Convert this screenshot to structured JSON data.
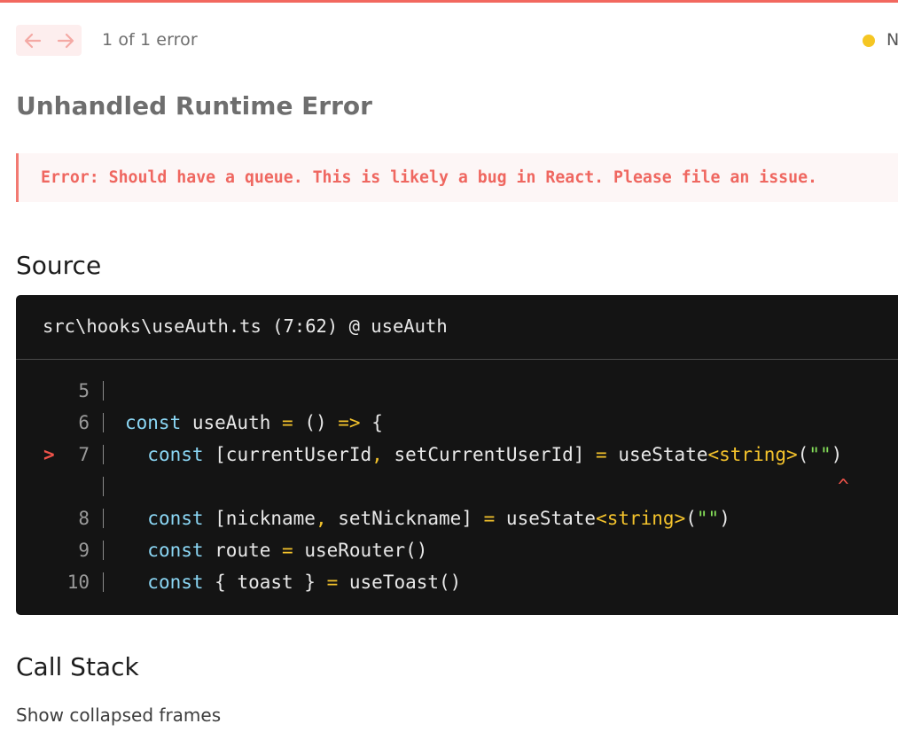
{
  "toolbar": {
    "error_count": "1 of 1 error",
    "status_text": "N"
  },
  "title": "Unhandled Runtime Error",
  "error_message": "Error: Should have a queue. This is likely a bug in React. Please file an issue.",
  "source": {
    "heading": "Source",
    "file_location": "src\\hooks\\useAuth.ts (7:62) @ useAuth",
    "lines": [
      {
        "num": "5",
        "code": ""
      },
      {
        "num": "6",
        "code": "const useAuth = () => {"
      },
      {
        "num": "7",
        "code": "  const [currentUserId, setCurrentUserId] = useState<string>(\"\")",
        "highlighted": true
      },
      {
        "num": "",
        "code": "^",
        "caret": true
      },
      {
        "num": "8",
        "code": "  const [nickname, setNickname] = useState<string>(\"\")"
      },
      {
        "num": "9",
        "code": "  const route = useRouter()"
      },
      {
        "num": "10",
        "code": "  const { toast } = useToast()"
      }
    ],
    "highlight_marker": ">"
  },
  "call_stack": {
    "heading": "Call Stack",
    "toggle_label": "Show collapsed frames"
  },
  "colors": {
    "accent_red": "#f2685f",
    "status_yellow": "#f5c623",
    "code_bg": "#141414",
    "keyword": "#8bd7f5",
    "operator": "#f4c32c",
    "string": "#86e15a"
  },
  "icons": [
    "arrow-left-icon",
    "arrow-right-icon",
    "status-dot-icon",
    "line-marker-icon"
  ]
}
